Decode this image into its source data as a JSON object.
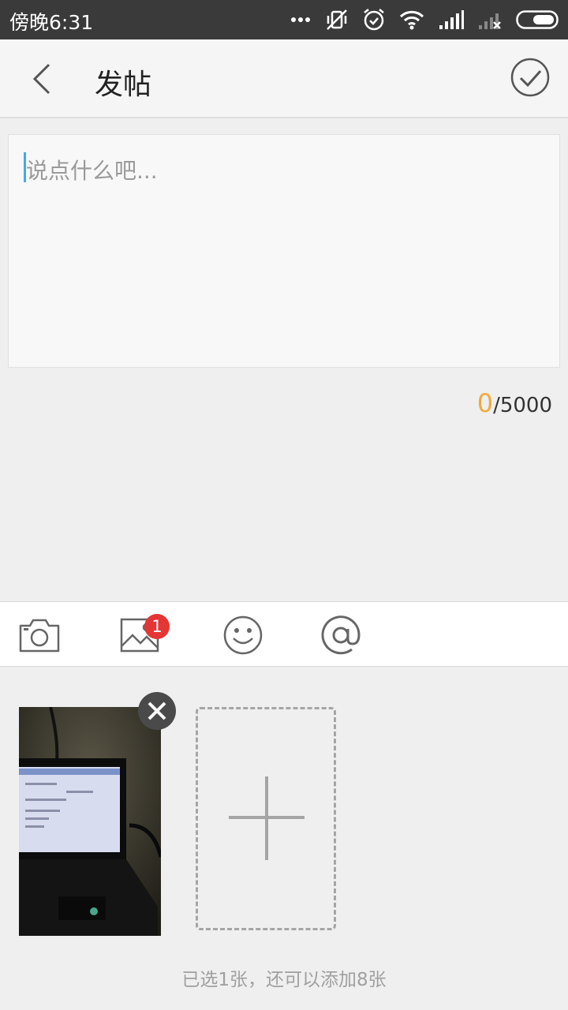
{
  "status_bar": {
    "time": "傍晚6:31",
    "icons": [
      "more-dots-icon",
      "vibrate-off-icon",
      "alarm-icon",
      "wifi-icon",
      "signal-icon",
      "signal-off-icon",
      "battery-icon"
    ]
  },
  "header": {
    "title": "发帖",
    "back_icon": "chevron-left-icon",
    "confirm_icon": "check-circle-icon"
  },
  "editor": {
    "placeholder": "说点什么吧...",
    "value": ""
  },
  "counter": {
    "current": "0",
    "separator_max": "/5000"
  },
  "toolbar": {
    "items": [
      "camera-icon",
      "image-icon",
      "emoji-icon",
      "at-icon"
    ],
    "image_badge": "1"
  },
  "attachments": {
    "photo_icon": "photo-thumbnail",
    "remove_icon": "close-icon",
    "add_icon": "plus-icon",
    "hint": "已选1张，还可以添加8张"
  },
  "colors": {
    "accent_count": "#f2a93b",
    "badge": "#e53535",
    "cursor": "#47a5f5"
  }
}
